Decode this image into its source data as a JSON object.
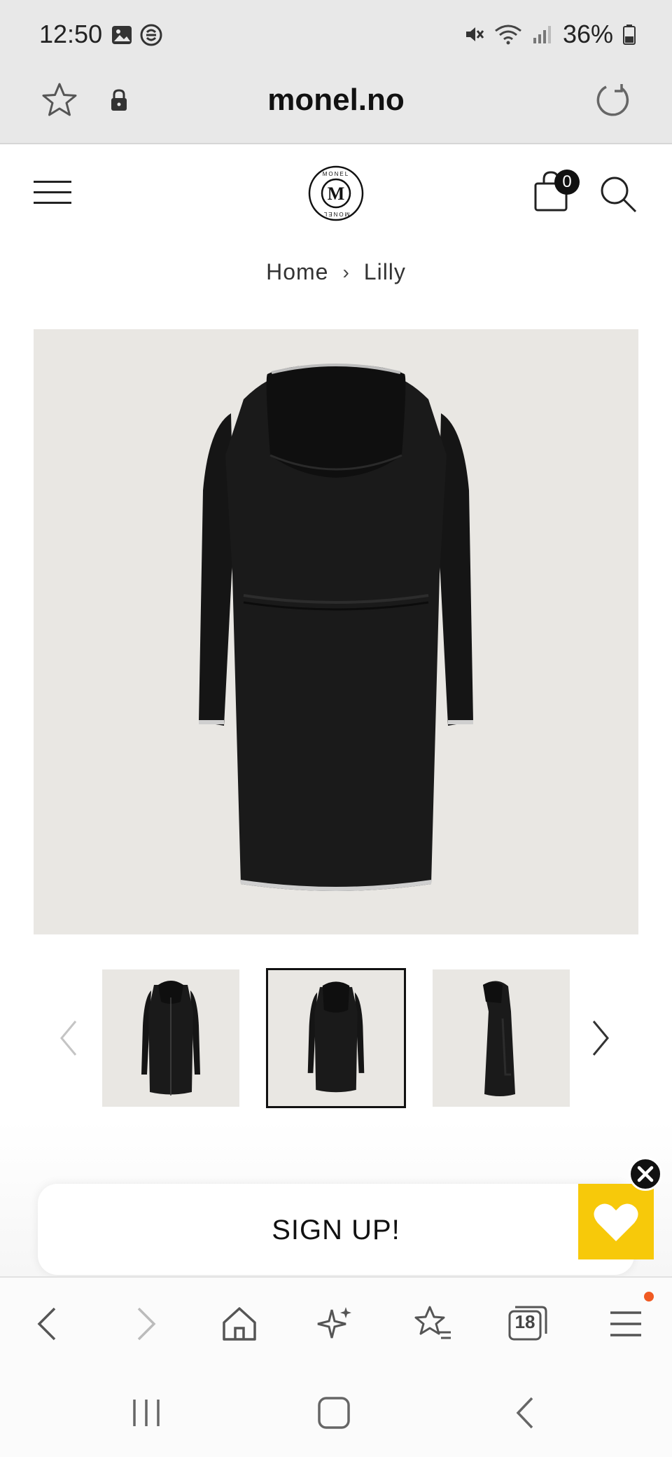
{
  "status_bar": {
    "time": "12:50",
    "battery": "36%"
  },
  "url_bar": {
    "url": "monel.no"
  },
  "header": {
    "logo_letter": "M",
    "logo_ring_text": "MONEL",
    "cart_count": "0"
  },
  "breadcrumb": {
    "items": [
      "Home",
      "Lilly"
    ],
    "separator": "›"
  },
  "gallery": {
    "active_index": 1,
    "thumbnail_count": 3
  },
  "signup": {
    "label": "SIGN UP!"
  },
  "browser_toolbar": {
    "tabs_count": "18"
  },
  "colors": {
    "accent_yellow": "#f7c90a",
    "notification_orange": "#f05a22",
    "image_bg": "#e9e7e3"
  },
  "icons": {
    "status_left": [
      "gallery-icon",
      "shazam-icon"
    ],
    "status_right": [
      "mute-icon",
      "wifi-icon",
      "signal-icon",
      "battery-icon"
    ],
    "toolbar": [
      "back-icon",
      "forward-icon",
      "home-icon",
      "sparkle-icon",
      "bookmarks-icon",
      "tabs-icon",
      "menu-icon"
    ],
    "android_nav": [
      "recents-icon",
      "home-icon",
      "back-icon"
    ]
  }
}
